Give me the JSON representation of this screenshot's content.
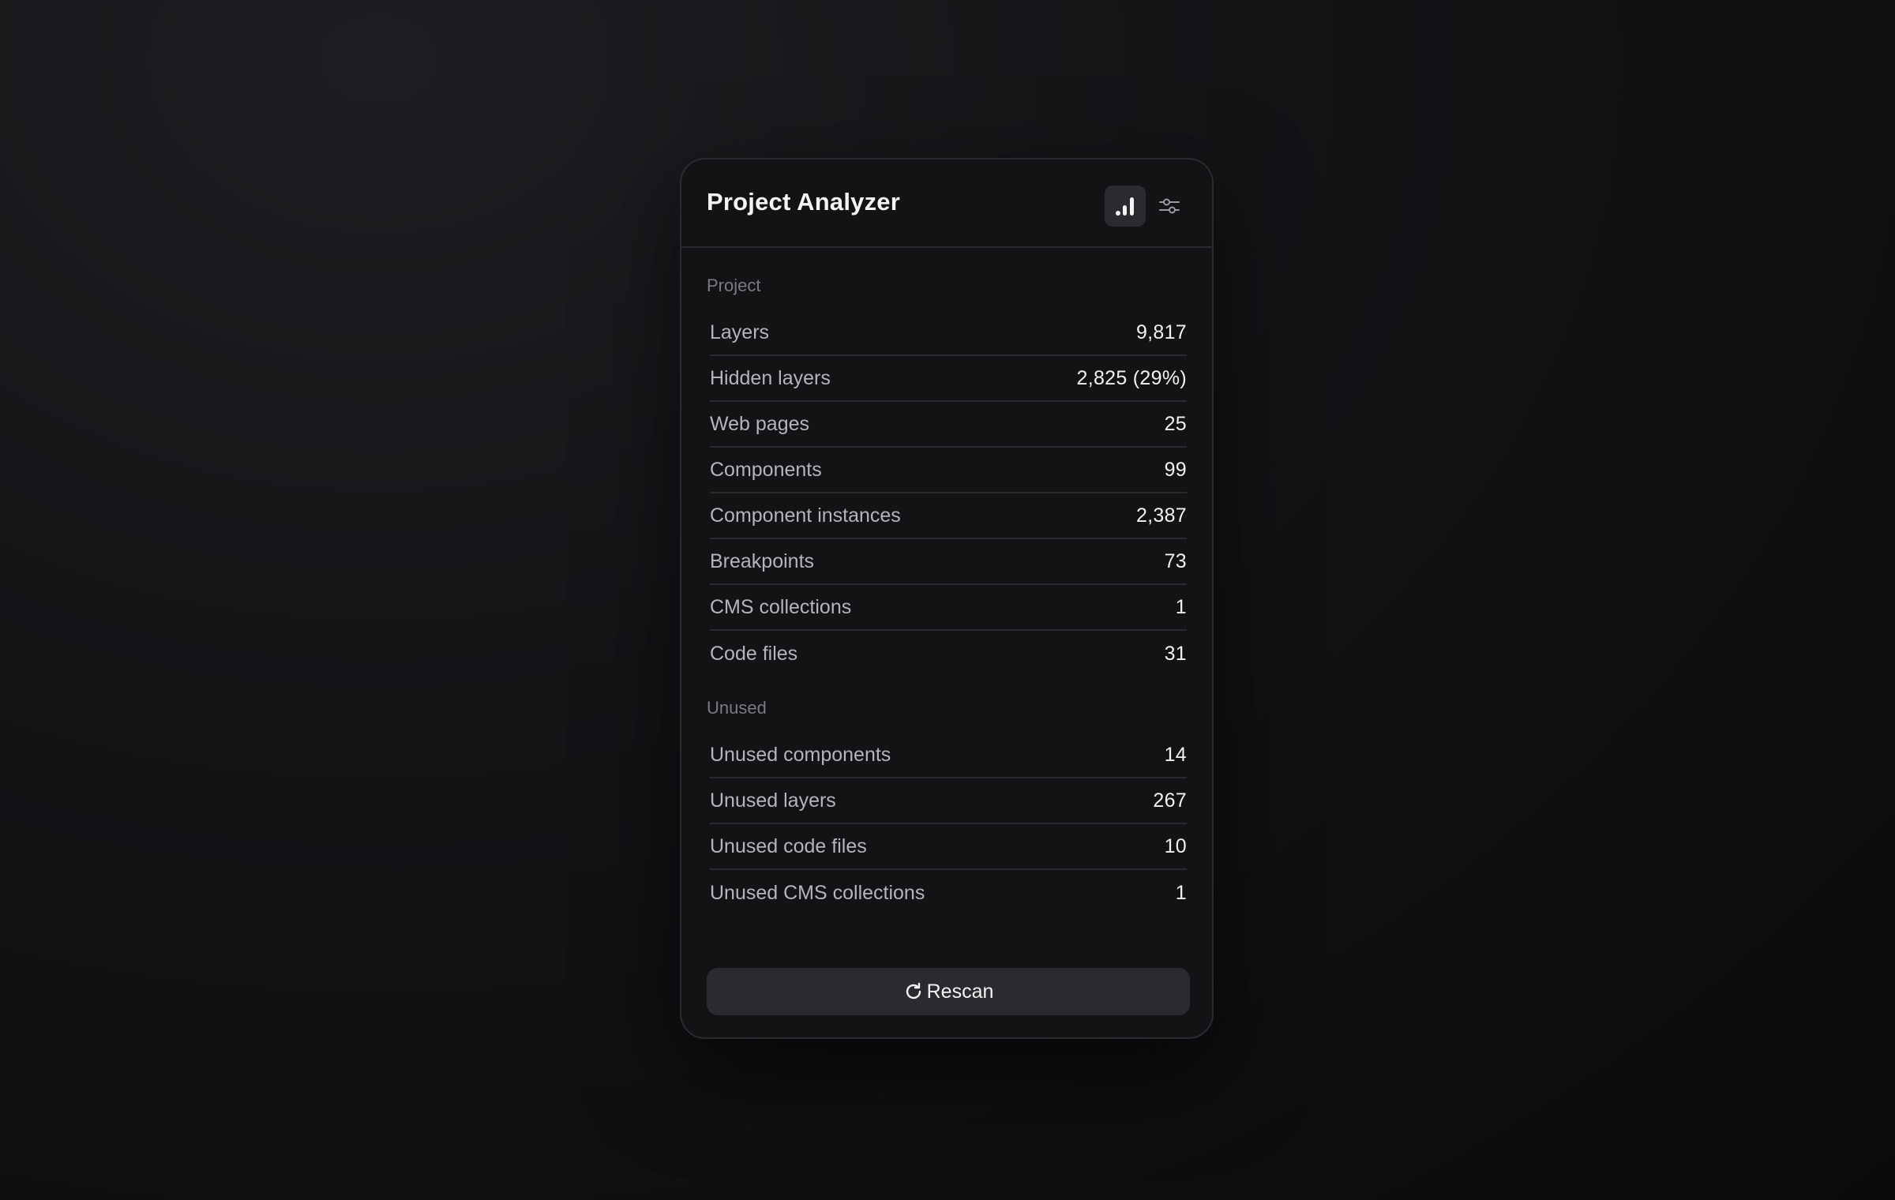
{
  "app": {
    "title": "Project Analyzer"
  },
  "toolbar": {
    "tabs": [
      {
        "icon": "bar-chart-icon",
        "active": true
      },
      {
        "icon": "sliders-icon",
        "active": false
      }
    ]
  },
  "project": {
    "heading": "Project",
    "rows": [
      {
        "label": "Layers",
        "value": "9,817"
      },
      {
        "label": "Hidden layers",
        "value": "2,825 (29%)"
      },
      {
        "label": "Web pages",
        "value": "25"
      },
      {
        "label": "Components",
        "value": "99"
      },
      {
        "label": "Component instances",
        "value": "2,387"
      },
      {
        "label": "Breakpoints",
        "value": "73"
      },
      {
        "label": "CMS collections",
        "value": "1"
      },
      {
        "label": "Code files",
        "value": "31"
      }
    ]
  },
  "unused": {
    "heading": "Unused",
    "rows": [
      {
        "label": "Unused components",
        "value": "14"
      },
      {
        "label": "Unused layers",
        "value": "267"
      },
      {
        "label": "Unused code files",
        "value": "10"
      },
      {
        "label": "Unused CMS collections",
        "value": "1"
      }
    ]
  },
  "actions": {
    "rescan_label": "Rescan",
    "rescan_icon": "refresh-icon"
  },
  "colors": {
    "panel_bg": "#131316",
    "button_bg": "#2a2a2f",
    "text_primary": "#f4f4f5",
    "text_secondary": "#b4b4ba",
    "text_muted": "#7a7a80"
  }
}
